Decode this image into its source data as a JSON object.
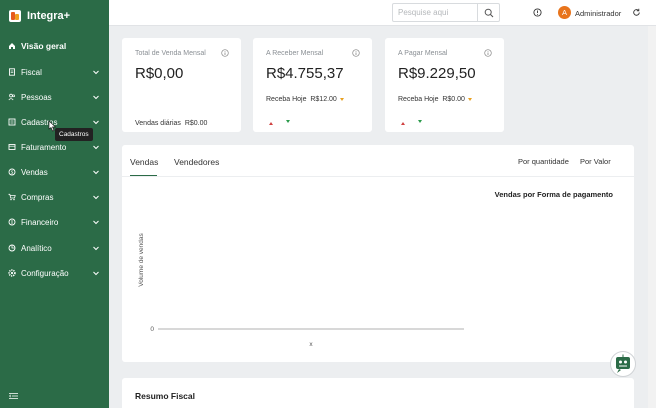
{
  "brand": {
    "name": "Integra+"
  },
  "nav": [
    {
      "label": "Visão geral",
      "icon": "home-icon",
      "active": true,
      "has_chevron": false
    },
    {
      "label": "Fiscal",
      "icon": "document-icon",
      "has_chevron": true
    },
    {
      "label": "Pessoas",
      "icon": "people-icon",
      "has_chevron": true
    },
    {
      "label": "Cadastros",
      "icon": "form-icon",
      "has_chevron": true
    },
    {
      "label": "Faturamento",
      "icon": "invoice-icon",
      "has_chevron": true
    },
    {
      "label": "Vendas",
      "icon": "sales-icon",
      "has_chevron": true
    },
    {
      "label": "Compras",
      "icon": "cart-icon",
      "has_chevron": true
    },
    {
      "label": "Financeiro",
      "icon": "money-icon",
      "has_chevron": true
    },
    {
      "label": "Analítico",
      "icon": "analytics-icon",
      "has_chevron": true
    },
    {
      "label": "Configuração",
      "icon": "gear-icon",
      "has_chevron": true
    }
  ],
  "tooltip": {
    "text": "Cadastros"
  },
  "topbar": {
    "search_placeholder": "Pesquise aqui",
    "avatar_initial": "A",
    "user_name": "Administrador"
  },
  "cards": [
    {
      "title": "Total de Venda Mensal",
      "value": "R$0,00",
      "footer_label": "Vendas diárias",
      "footer_value": "R$0.00"
    },
    {
      "title": "A Receber Mensal",
      "value": "R$4.755,37",
      "sub_label": "Receba Hoje",
      "sub_value": "R$12.00"
    },
    {
      "title": "A Pagar Mensal",
      "value": "R$9.229,50",
      "sub_label": "Receba Hoje",
      "sub_value": "R$0.00"
    }
  ],
  "sales_panel": {
    "tabs": [
      "Vendas",
      "Vendedores"
    ],
    "active_tab": "Vendas",
    "filters": [
      "Por quantidade",
      "Por Valor"
    ]
  },
  "chart_data": {
    "type": "line",
    "title": "Vendas por Forma de pagamento",
    "xlabel": "x",
    "ylabel": "Volume de vendas",
    "y_ticks": [
      "0"
    ],
    "series": []
  },
  "fiscal_panel": {
    "title": "Resumo Fiscal"
  },
  "colors": {
    "sidebar": "#2b6b47",
    "accent": "#2b6b47",
    "avatar": "#e8741c"
  }
}
